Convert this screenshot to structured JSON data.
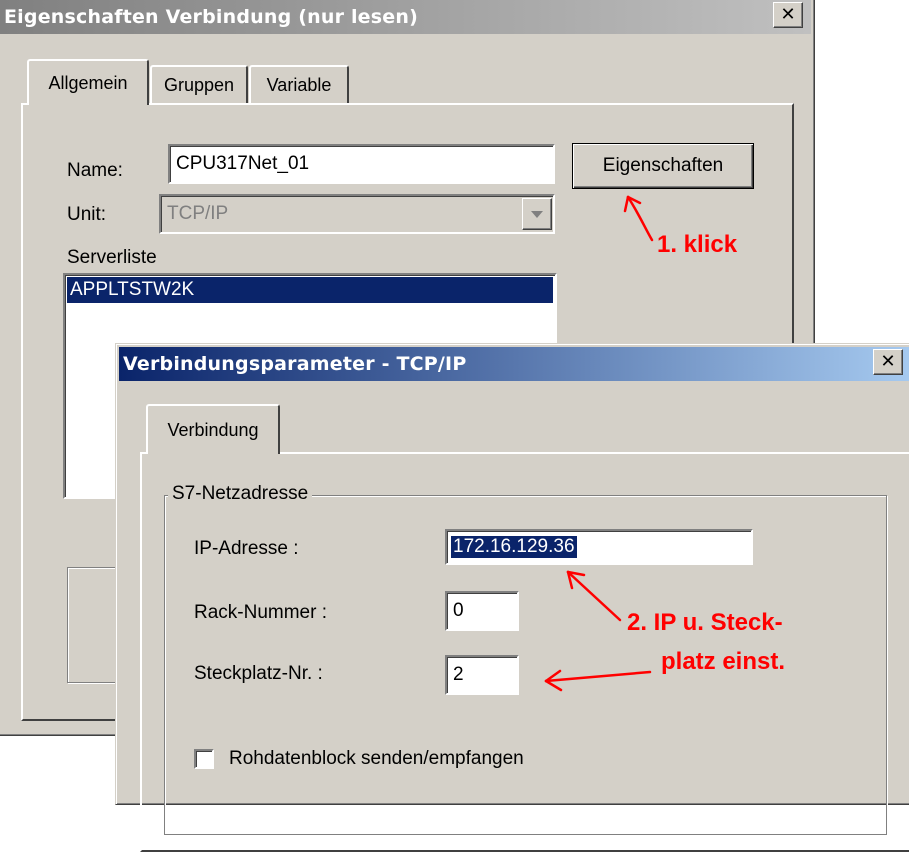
{
  "main_dialog": {
    "title": "Eigenschaften Verbindung (nur lesen)",
    "close_glyph": "✕",
    "tabs": [
      {
        "label": "Allgemein",
        "active": true
      },
      {
        "label": "Gruppen",
        "active": false
      },
      {
        "label": "Variable",
        "active": false
      }
    ],
    "name_label": "Name:",
    "name_value": "CPU317Net_01",
    "properties_button": "Eigenschaften",
    "unit_label": "Unit:",
    "unit_value": "TCP/IP",
    "serverlist_label": "Serverliste",
    "serverlist_items": [
      {
        "label": "APPLTSTW2K",
        "selected": true
      }
    ]
  },
  "sub_dialog": {
    "title": "Verbindungsparameter - TCP/IP",
    "close_glyph": "✕",
    "tab_label": "Verbindung",
    "group_label": "S7-Netzadresse",
    "ip_label": "IP-Adresse :",
    "ip_value": "172.16.129.36",
    "rack_label": "Rack-Nummer :",
    "rack_value": "0",
    "slot_label": "Steckplatz-Nr. :",
    "slot_value": "2",
    "rawdata_label": "Rohdatenblock senden/empfangen",
    "rawdata_checked": false
  },
  "annotations": {
    "step1": "1. klick",
    "step2_line1": "2. IP u. Steck-",
    "step2_line2": "platz einst."
  },
  "colors": {
    "face": "#d4d0c8",
    "title_gradient_start": "#0a246a",
    "title_gradient_end": "#a6caf0",
    "selection": "#0a246a",
    "annotation": "#ff0000"
  }
}
